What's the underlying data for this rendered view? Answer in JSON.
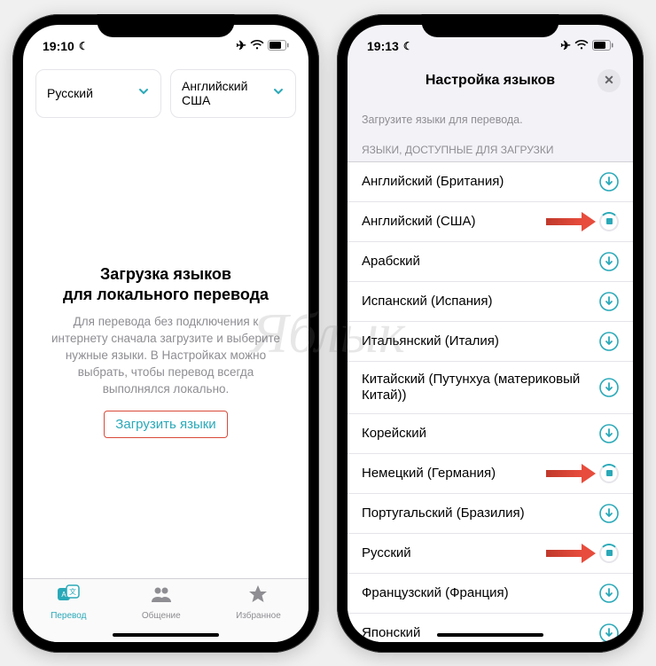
{
  "left": {
    "status": {
      "time": "19:10"
    },
    "selectors": {
      "source": "Русский",
      "target_line1": "Английский",
      "target_line2": "США"
    },
    "empty": {
      "title_line1": "Загрузка языков",
      "title_line2": "для локального перевода",
      "body": "Для перевода без подключения к интернету сначала загрузите и выберите нужные языки. В Настройках можно выбрать, чтобы перевод всегда выполнялся локально.",
      "button": "Загрузить языки"
    },
    "tabs": {
      "translate": "Перевод",
      "chat": "Общение",
      "fav": "Избранное"
    }
  },
  "right": {
    "status": {
      "time": "19:13"
    },
    "title": "Настройка языков",
    "description": "Загрузите языки для перевода.",
    "section": "ЯЗЫКИ, ДОСТУПНЫЕ ДЛЯ ЗАГРУЗКИ",
    "langs": [
      {
        "name": "Английский (Британия)",
        "state": "download"
      },
      {
        "name": "Английский (США)",
        "state": "loading",
        "arrow": true
      },
      {
        "name": "Арабский",
        "state": "download"
      },
      {
        "name": "Испанский (Испания)",
        "state": "download"
      },
      {
        "name": "Итальянский (Италия)",
        "state": "download"
      },
      {
        "name": "Китайский (Путунхуа (материковый Китай))",
        "state": "download"
      },
      {
        "name": "Корейский",
        "state": "download"
      },
      {
        "name": "Немецкий (Германия)",
        "state": "loading",
        "arrow": true
      },
      {
        "name": "Португальский (Бразилия)",
        "state": "download"
      },
      {
        "name": "Русский",
        "state": "loading",
        "arrow": true
      },
      {
        "name": "Французский (Франция)",
        "state": "download"
      },
      {
        "name": "Японский",
        "state": "download"
      }
    ]
  },
  "colors": {
    "accent": "#2aa9b8",
    "highlight_border": "#d94a3a"
  },
  "watermark": "Яблык"
}
